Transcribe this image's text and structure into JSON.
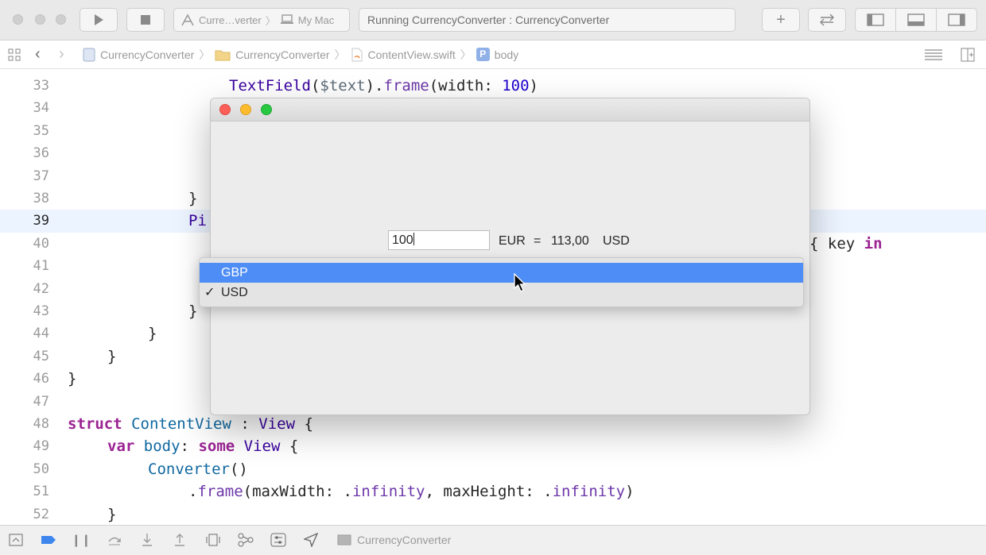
{
  "toolbar": {
    "scheme_target": "Curre…verter",
    "scheme_device": "My Mac",
    "activity_status": "Running CurrencyConverter : CurrencyConverter"
  },
  "jumpbar": {
    "crumbs": [
      "CurrencyConverter",
      "CurrencyConverter",
      "ContentView.swift",
      "body"
    ]
  },
  "editor": {
    "lines": [
      {
        "num": "33"
      },
      {
        "num": "34"
      },
      {
        "num": "35"
      },
      {
        "num": "36"
      },
      {
        "num": "37"
      },
      {
        "num": "38"
      },
      {
        "num": "39"
      },
      {
        "num": "40"
      },
      {
        "num": "41"
      },
      {
        "num": "42"
      },
      {
        "num": "43"
      },
      {
        "num": "44"
      },
      {
        "num": "45"
      },
      {
        "num": "46"
      },
      {
        "num": "47"
      },
      {
        "num": "48"
      },
      {
        "num": "49"
      },
      {
        "num": "50"
      },
      {
        "num": "51"
      },
      {
        "num": "52"
      }
    ]
  },
  "app": {
    "amount_value": "100",
    "source_currency": "EUR",
    "equals": "=",
    "result_value": "113,00",
    "target_currency": "USD"
  },
  "popup": {
    "options": [
      {
        "label": "GBP",
        "check": ""
      },
      {
        "label": "USD",
        "check": "✓"
      }
    ]
  },
  "bottombar": {
    "target_label": "CurrencyConverter"
  },
  "colors": {
    "selection": "#4d8df5",
    "current_line": "#ecf4ff",
    "keyword": "#9b2393",
    "type": "#3900a0",
    "number": "#1c00cf"
  }
}
